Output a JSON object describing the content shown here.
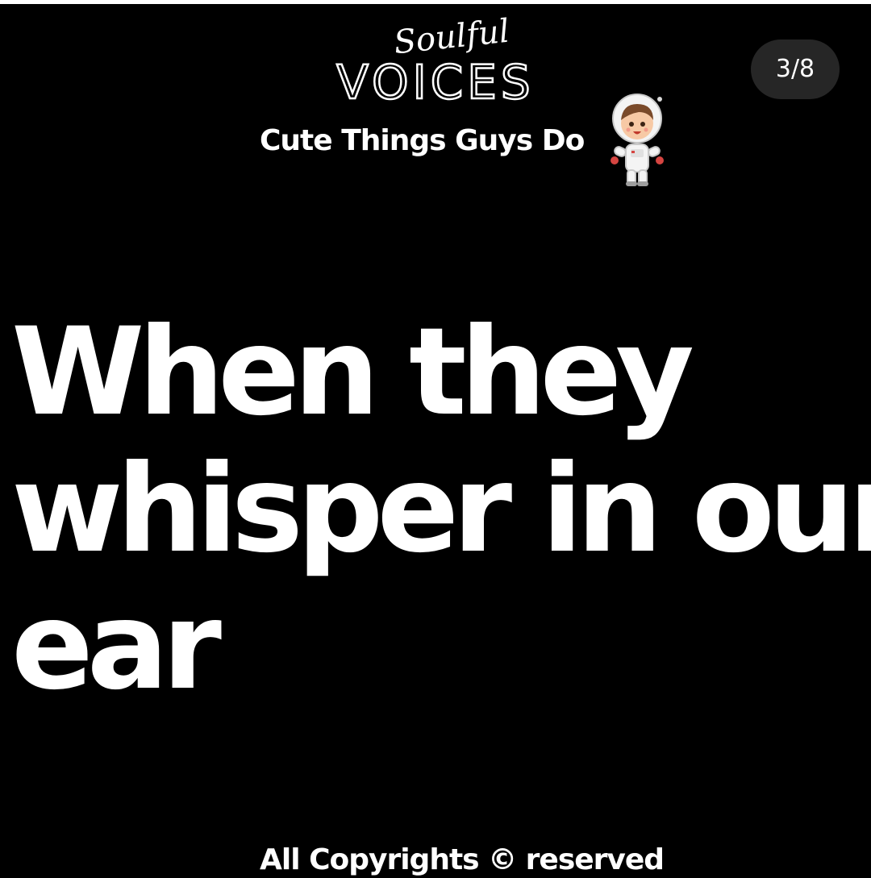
{
  "post": {
    "counter": "3/8",
    "brand": {
      "script": "Soulful",
      "main": "VOICES"
    },
    "subtitle": "Cute Things Guys Do",
    "sticker_icon": "astronaut-icon",
    "headline": {
      "lines": [
        "When they",
        "whisper in our",
        "ear"
      ]
    },
    "footer": "All Copyrights © reserved"
  },
  "colors": {
    "background": "#000000",
    "text": "#ffffff",
    "counter_bg": "#262626"
  }
}
